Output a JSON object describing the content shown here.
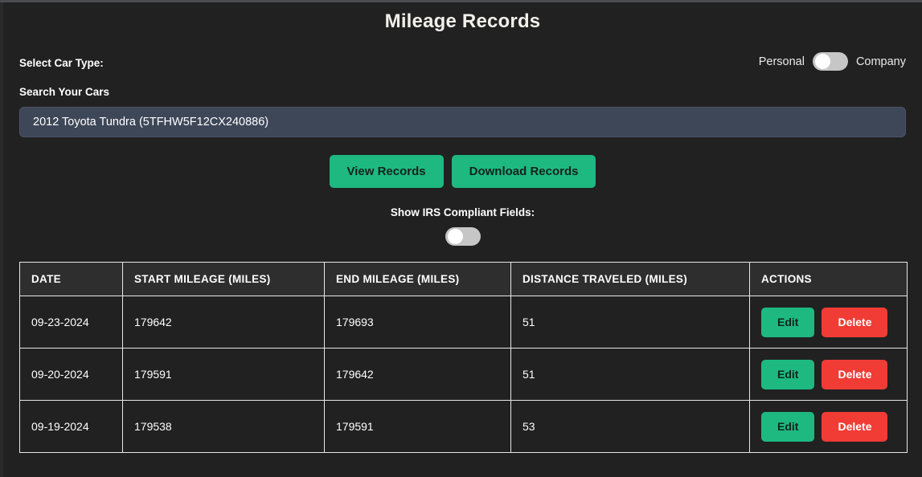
{
  "header": {
    "title": "Mileage Records"
  },
  "car_type": {
    "label": "Select Car Type:",
    "left_option": "Personal",
    "right_option": "Company",
    "selected": "Personal",
    "toggle_state": "off"
  },
  "search": {
    "label": "Search Your Cars",
    "value": "2012 Toyota Tundra (5TFHW5F12CX240886)",
    "placeholder": "Search Your Cars"
  },
  "actions": {
    "view_records": "View Records",
    "download_records": "Download Records"
  },
  "irs": {
    "label": "Show IRS Compliant Fields:",
    "toggle_state": "off"
  },
  "table": {
    "columns": [
      "DATE",
      "START MILEAGE (MILES)",
      "END MILEAGE (MILES)",
      "DISTANCE TRAVELED (MILES)",
      "ACTIONS"
    ],
    "row_actions": {
      "edit": "Edit",
      "delete": "Delete"
    },
    "rows": [
      {
        "date": "09-23-2024",
        "start_mileage": "179642",
        "end_mileage": "179693",
        "distance": "51"
      },
      {
        "date": "09-20-2024",
        "start_mileage": "179591",
        "end_mileage": "179642",
        "distance": "51"
      },
      {
        "date": "09-19-2024",
        "start_mileage": "179538",
        "end_mileage": "179591",
        "distance": "53"
      }
    ]
  },
  "colors": {
    "background": "#212121",
    "accent_green": "#1db981",
    "danger_red": "#f03c35",
    "input_background": "#3e4758",
    "table_border": "#e8e8e8"
  }
}
